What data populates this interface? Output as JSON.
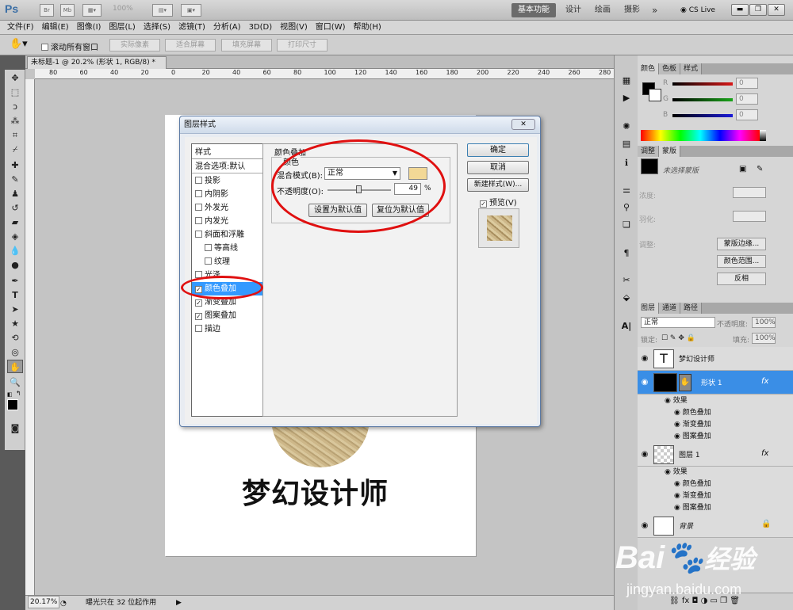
{
  "titlebar": {
    "logo": "Ps",
    "icon_br": "Br",
    "icon_mb": "Mb",
    "zoom": "100%",
    "workspaces": [
      "基本功能",
      "设计",
      "绘画",
      "摄影"
    ],
    "more": "»",
    "cslive": "CS Live"
  },
  "menu": [
    "文件(F)",
    "编辑(E)",
    "图像(I)",
    "图层(L)",
    "选择(S)",
    "滤镜(T)",
    "分析(A)",
    "3D(D)",
    "视图(V)",
    "窗口(W)",
    "帮助(H)"
  ],
  "options": {
    "scroll_all": "滚动所有窗口",
    "actual_pixels": "实际像素",
    "fit_screen": "适合屏幕",
    "fill_screen": "填充屏幕",
    "print_size": "打印尺寸"
  },
  "doc_tab": "未标题-1 @ 20.2% (形状 1, RGB/8) *",
  "ruler_labels": [
    "80",
    "60",
    "40",
    "20",
    "0",
    "20",
    "40",
    "60",
    "80",
    "100",
    "120",
    "140",
    "160",
    "180",
    "200",
    "220",
    "240",
    "260",
    "280"
  ],
  "canvas": {
    "text": "梦幻设计师"
  },
  "status": {
    "zoom": "20.17%",
    "message": "曝光只在 32 位起作用"
  },
  "dialog": {
    "title": "图层样式",
    "styles_header": "样式",
    "blend_default": "混合选项:默认",
    "styles": [
      {
        "label": "投影",
        "checked": false,
        "indent": false
      },
      {
        "label": "内阴影",
        "checked": false,
        "indent": false
      },
      {
        "label": "外发光",
        "checked": false,
        "indent": false
      },
      {
        "label": "内发光",
        "checked": false,
        "indent": false
      },
      {
        "label": "斜面和浮雕",
        "checked": false,
        "indent": false
      },
      {
        "label": "等高线",
        "checked": false,
        "indent": true
      },
      {
        "label": "纹理",
        "checked": false,
        "indent": true
      },
      {
        "label": "光泽",
        "checked": false,
        "indent": false
      },
      {
        "label": "颜色叠加",
        "checked": true,
        "indent": false,
        "selected": true
      },
      {
        "label": "渐变叠加",
        "checked": true,
        "indent": false
      },
      {
        "label": "图案叠加",
        "checked": true,
        "indent": false
      },
      {
        "label": "描边",
        "checked": false,
        "indent": false
      }
    ],
    "section_title": "颜色叠加",
    "group_title": "颜色",
    "blend_mode_label": "混合模式(B):",
    "blend_mode_value": "正常",
    "overlay_color": "#f2d896",
    "opacity_label": "不透明度(O):",
    "opacity_value": "49",
    "opacity_unit": "%",
    "set_default": "设置为默认值",
    "reset_default": "复位为默认值",
    "ok": "确定",
    "cancel": "取消",
    "new_style": "新建样式(W)...",
    "preview_label": "预览(V)"
  },
  "color_panel": {
    "tabs": [
      "颜色",
      "色板",
      "样式"
    ],
    "channels": [
      {
        "label": "R",
        "value": "0",
        "color": "#d81818"
      },
      {
        "label": "G",
        "value": "0",
        "color": "#1aa51a"
      },
      {
        "label": "B",
        "value": "0",
        "color": "#1a1ad8"
      }
    ]
  },
  "masks_panel": {
    "tabs": [
      "调整",
      "蒙版"
    ],
    "no_mask": "未选择蒙版",
    "density": "浓度:",
    "feather": "羽化:",
    "refine": "调整:",
    "mask_edge": "蒙版边缘...",
    "color_range": "颜色范围...",
    "invert": "反相"
  },
  "layers_panel": {
    "tabs": [
      "图层",
      "通道",
      "路径"
    ],
    "blend": "正常",
    "opacity_label": "不透明度:",
    "opacity": "100%",
    "lock_label": "锁定:",
    "fill_label": "填充:",
    "fill": "100%",
    "text_layer": "梦幻设计师",
    "shape_layer": "形状 1",
    "effects_label": "效果",
    "effects": [
      "颜色叠加",
      "渐变叠加",
      "图案叠加"
    ],
    "layer1": "图层 1",
    "layer1_effects": [
      "颜色叠加",
      "渐变叠加",
      "图案叠加"
    ],
    "background": "背景",
    "fx": "fx",
    "text_thumb": "T"
  },
  "watermark": {
    "brand": "Bai",
    "brand2": "经验",
    "url": "jingyan.baidu.com"
  }
}
